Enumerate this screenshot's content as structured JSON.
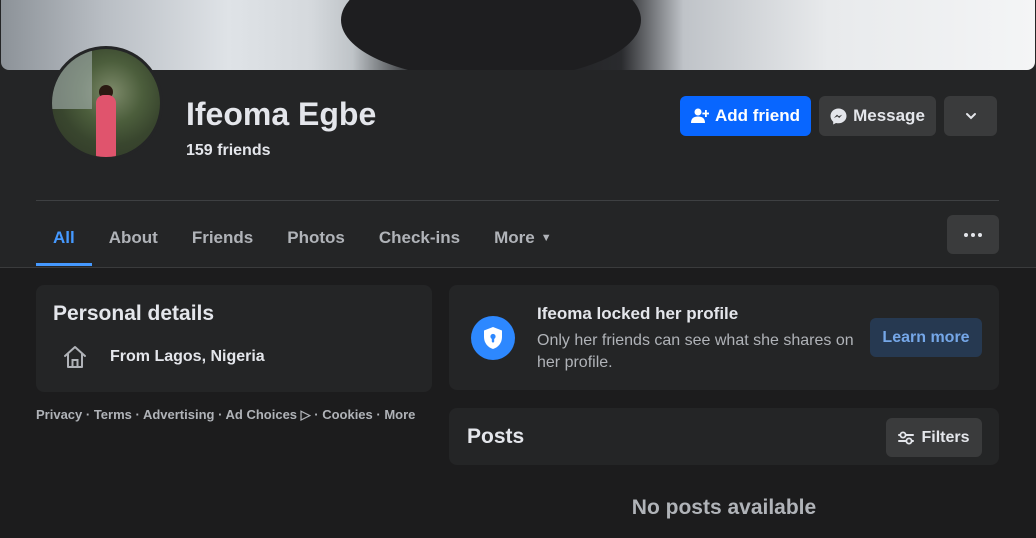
{
  "profile": {
    "name": "Ifeoma Egbe",
    "friends_count": "159 friends"
  },
  "actions": {
    "add_friend": "Add friend",
    "message": "Message"
  },
  "tabs": [
    {
      "label": "All",
      "active": true
    },
    {
      "label": "About"
    },
    {
      "label": "Friends"
    },
    {
      "label": "Photos"
    },
    {
      "label": "Check-ins"
    },
    {
      "label": "More"
    }
  ],
  "personal_details": {
    "title": "Personal details",
    "hometown": "From Lagos, Nigeria"
  },
  "footer": {
    "links": "Privacy · Terms · Advertising · Ad Choices ▷ · Cookies · More"
  },
  "locked": {
    "title": "Ifeoma locked her profile",
    "description": "Only her friends can see what she shares on her profile.",
    "learn_more": "Learn more"
  },
  "posts": {
    "title": "Posts",
    "filters": "Filters",
    "empty": "No posts available"
  },
  "colors": {
    "background": "#1c1c1d",
    "surface": "#242526",
    "primary": "#0866ff",
    "accent": "#4599ff"
  }
}
